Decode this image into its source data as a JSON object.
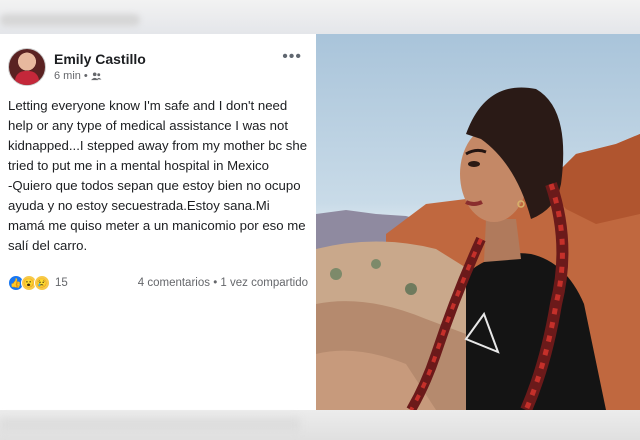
{
  "post": {
    "author": "Emily Castillo",
    "time": "6 min",
    "separator": "•",
    "audience_icon": "friends-icon",
    "more_icon": "more-options-icon",
    "more_label": "•••",
    "text": "Letting everyone know I'm safe and I don't need help or any type of medical assistance I was not kidnapped...I stepped away from my mother bc she tried to put me in a mental hospital in Mexico\n-Quiero que todos sepan que estoy bien no ocupo ayuda y no estoy secuestrada.Estoy sana.Mi mamá me quiso meter a un manicomio por eso me salí del carro.",
    "reactions": [
      "like",
      "wow",
      "sad"
    ],
    "reaction_count": "15",
    "comments": "4 comentarios",
    "stats_separator": "•",
    "shares": "1 vez compartido"
  },
  "colors": {
    "like": "#1877f2",
    "emoji": "#f7c948",
    "secondary_text": "#65676b"
  }
}
